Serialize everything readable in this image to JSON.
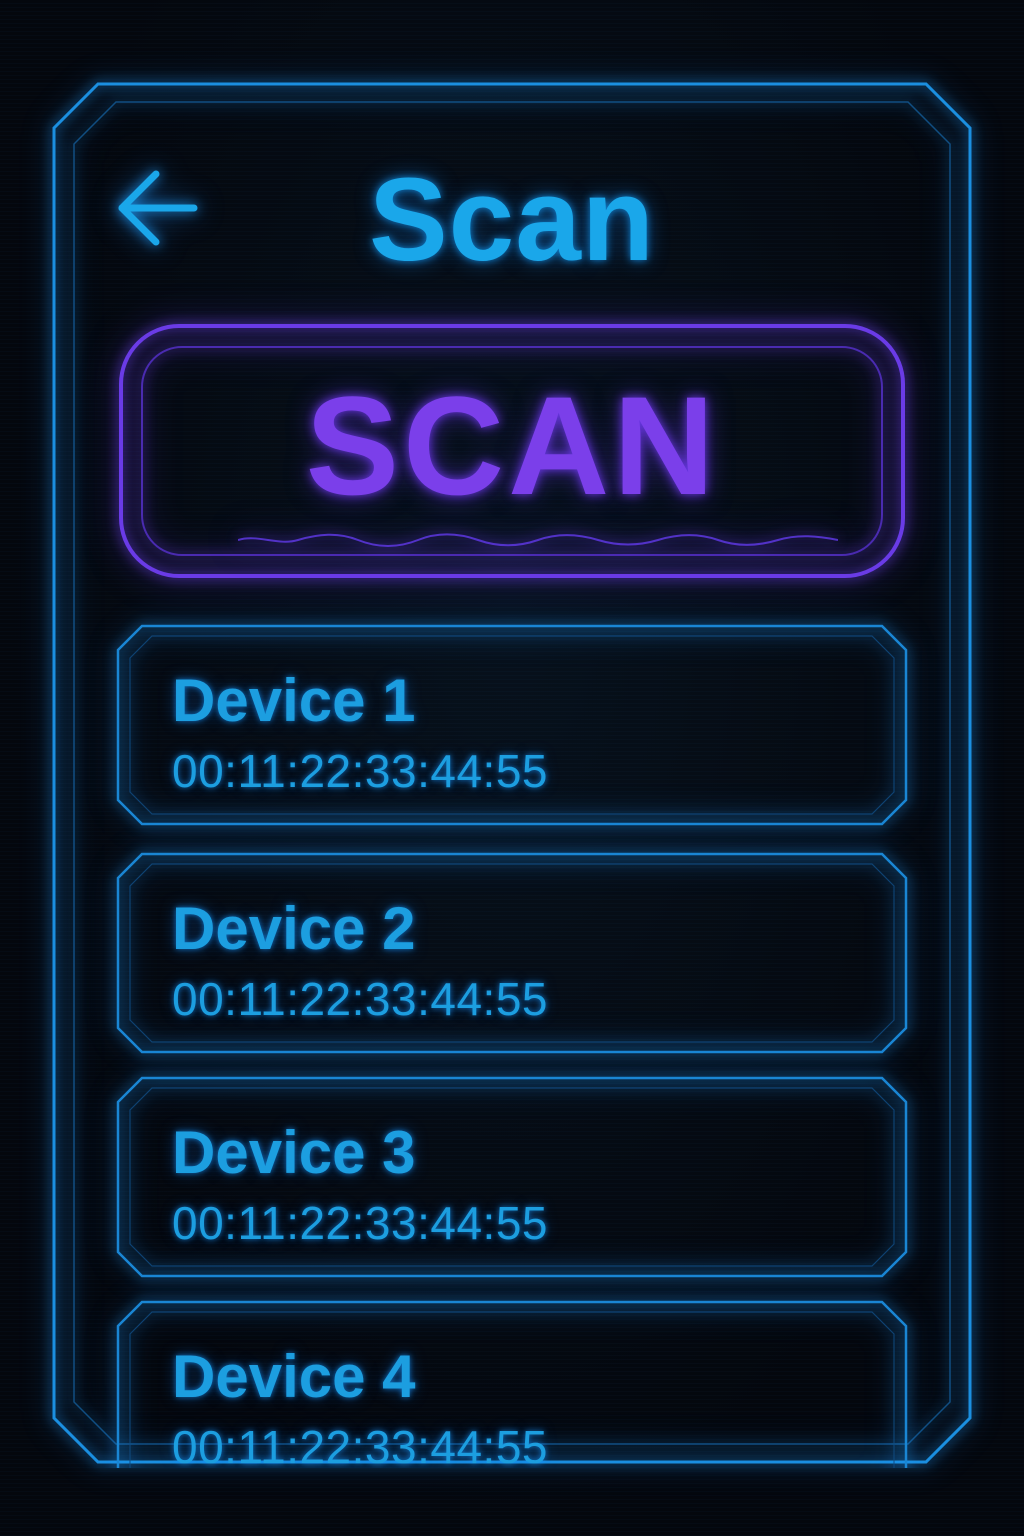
{
  "header": {
    "title": "Scan",
    "back_icon": "arrow-left-icon"
  },
  "scan_button": {
    "label": "SCAN"
  },
  "devices": [
    {
      "name": "Device 1",
      "mac": "00:11:22:33:44:55"
    },
    {
      "name": "Device 2",
      "mac": "00:11:22:33:44:55"
    },
    {
      "name": "Device 3",
      "mac": "00:11:22:33:44:55"
    },
    {
      "name": "Device 4",
      "mac": "00:11:22:33:44:55"
    }
  ],
  "colors": {
    "background": "#04070d",
    "accent_cyan": "#1aa7ea",
    "accent_purple": "#7b3fea",
    "frame_line": "#1b8fe0"
  }
}
